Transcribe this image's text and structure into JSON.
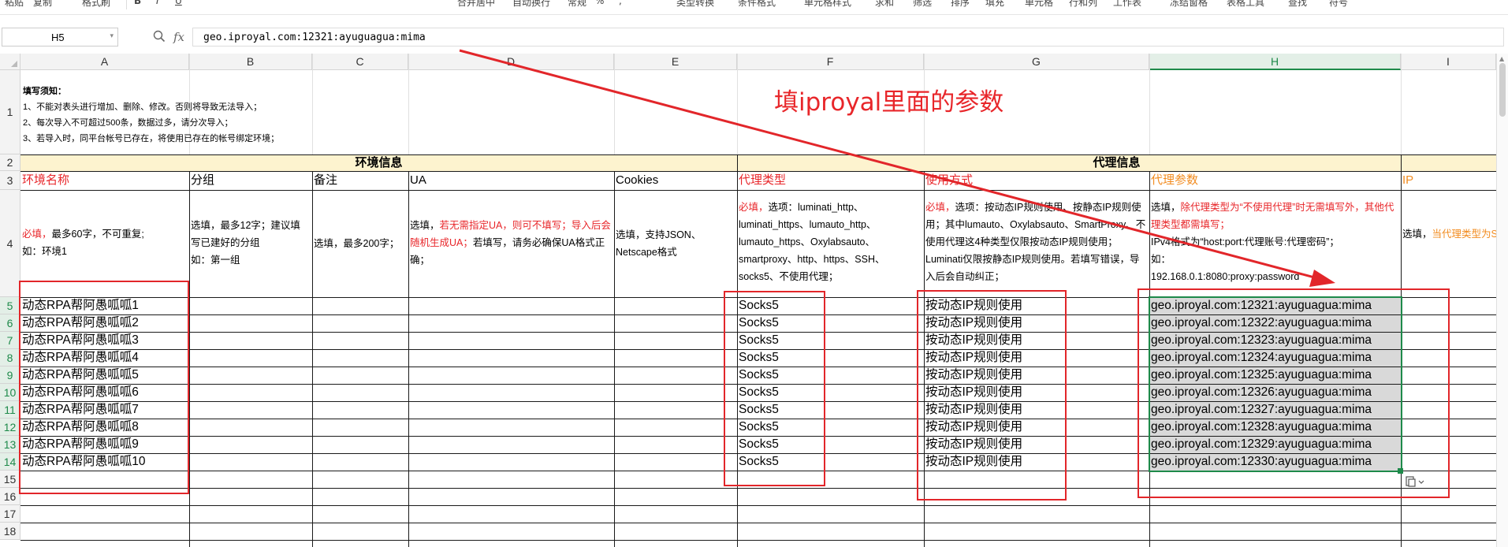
{
  "toolbar": {
    "items": [
      "粘贴",
      "复制",
      "格式刷",
      "B",
      "I",
      "U",
      "合并居中",
      "自动换行",
      "常规",
      "%",
      ",",
      "类型转换",
      "条件格式",
      "单元格样式",
      "求和",
      "筛选",
      "排序",
      "填充",
      "单元格",
      "行和列",
      "工作表",
      "冻结窗格",
      "表格工具",
      "查找",
      "符号"
    ]
  },
  "formula_bar": {
    "cell_ref": "H5",
    "zoom_icon": "zoom-icon",
    "fx_label": "fx",
    "formula": "geo.iproyal.com:12321:ayuguagua:mima"
  },
  "columns": [
    "A",
    "B",
    "C",
    "D",
    "E",
    "F",
    "G",
    "H",
    "I"
  ],
  "selected_column": "H",
  "rows": [
    "1",
    "2",
    "3",
    "4",
    "5",
    "6",
    "7",
    "8",
    "9",
    "10",
    "11",
    "12",
    "13",
    "14",
    "15",
    "16",
    "17",
    "18"
  ],
  "notes": {
    "title": "填写须知：",
    "line1": "1、不能对表头进行增加、删除、修改。否则将导致无法导入；",
    "line2": "2、每次导入不可超过500条，数据过多，请分次导入；",
    "line3": "3、若导入时，同平台帐号已存在，将使用已存在的帐号绑定环境；"
  },
  "annotation": "填iproyal里面的参数",
  "sections": {
    "env": "环境信息",
    "proxy": "代理信息"
  },
  "headers": {
    "a": "环境名称",
    "b": "分组",
    "c": "备注",
    "d": "UA",
    "e": "Cookies",
    "f": "代理类型",
    "g": "使用方式",
    "h": "代理参数",
    "i": "IP"
  },
  "descriptions": {
    "a_req": "必填，",
    "a_rest": "最多60字，不可重复;",
    "a_ex": "如：环境1",
    "b": "选填，最多12字；建议填写已建好的分组",
    "b_ex": "如：第一组",
    "c": "选填，最多200字；",
    "d_pre": "选填，",
    "d_red": "若无需指定UA，则可不填写；导入后会随机生成UA；",
    "d_rest": "若填写，请务必确保UA格式正确；",
    "e": "选填，支持JSON、Netscape格式",
    "f_req": "必填，",
    "f_rest": "选项：luminati_http、luminati_https、lumauto_http、lumauto_https、Oxylabsauto、smartproxy、http、https、SSH、socks5、不使用代理；",
    "g_req": "必填，",
    "g_rest": "选项：按动态IP规则使用、按静态IP规则使用；其中lumauto、Oxylabsauto、SmartProxy、不使用代理这4种类型仅限按动态IP规则使用；Luminati仅限按静态IP规则使用。若填写错误，导入后会自动纠正；",
    "h_pre": "选填，",
    "h_red": "除代理类型为“不使用代理”时无需填写外，其他代理类型都需填写；",
    "h_rest1": "IPv4格式为“host:port:代理账号:代理密码”；",
    "h_ex": "如：",
    "h_ex2": "192.168.0.1:8080:proxy:password",
    "i_pre": "选填，",
    "i_orange": "当代理类型为SmartProxy时IP与国"
  },
  "data_rows": [
    {
      "name": "动态RPA帮阿愚呱呱1",
      "type": "Socks5",
      "mode": "按动态IP规则使用",
      "param": "geo.iproyal.com:12321:ayuguagua:mima"
    },
    {
      "name": "动态RPA帮阿愚呱呱2",
      "type": "Socks5",
      "mode": "按动态IP规则使用",
      "param": "geo.iproyal.com:12322:ayuguagua:mima"
    },
    {
      "name": "动态RPA帮阿愚呱呱3",
      "type": "Socks5",
      "mode": "按动态IP规则使用",
      "param": "geo.iproyal.com:12323:ayuguagua:mima"
    },
    {
      "name": "动态RPA帮阿愚呱呱4",
      "type": "Socks5",
      "mode": "按动态IP规则使用",
      "param": "geo.iproyal.com:12324:ayuguagua:mima"
    },
    {
      "name": "动态RPA帮阿愚呱呱5",
      "type": "Socks5",
      "mode": "按动态IP规则使用",
      "param": "geo.iproyal.com:12325:ayuguagua:mima"
    },
    {
      "name": "动态RPA帮阿愚呱呱6",
      "type": "Socks5",
      "mode": "按动态IP规则使用",
      "param": "geo.iproyal.com:12326:ayuguagua:mima"
    },
    {
      "name": "动态RPA帮阿愚呱呱7",
      "type": "Socks5",
      "mode": "按动态IP规则使用",
      "param": "geo.iproyal.com:12327:ayuguagua:mima"
    },
    {
      "name": "动态RPA帮阿愚呱呱8",
      "type": "Socks5",
      "mode": "按动态IP规则使用",
      "param": "geo.iproyal.com:12328:ayuguagua:mima"
    },
    {
      "name": "动态RPA帮阿愚呱呱9",
      "type": "Socks5",
      "mode": "按动态IP规则使用",
      "param": "geo.iproyal.com:12329:ayuguagua:mima"
    },
    {
      "name": "动态RPA帮阿愚呱呱10",
      "type": "Socks5",
      "mode": "按动态IP规则使用",
      "param": "geo.iproyal.com:12330:ayuguagua:mima"
    }
  ],
  "colors": {
    "annotation_red": "#e8262a",
    "selection_green": "#1e8a4a",
    "section_fill": "#fdf3cf",
    "selected_cell_fill": "#d9d9d9"
  }
}
